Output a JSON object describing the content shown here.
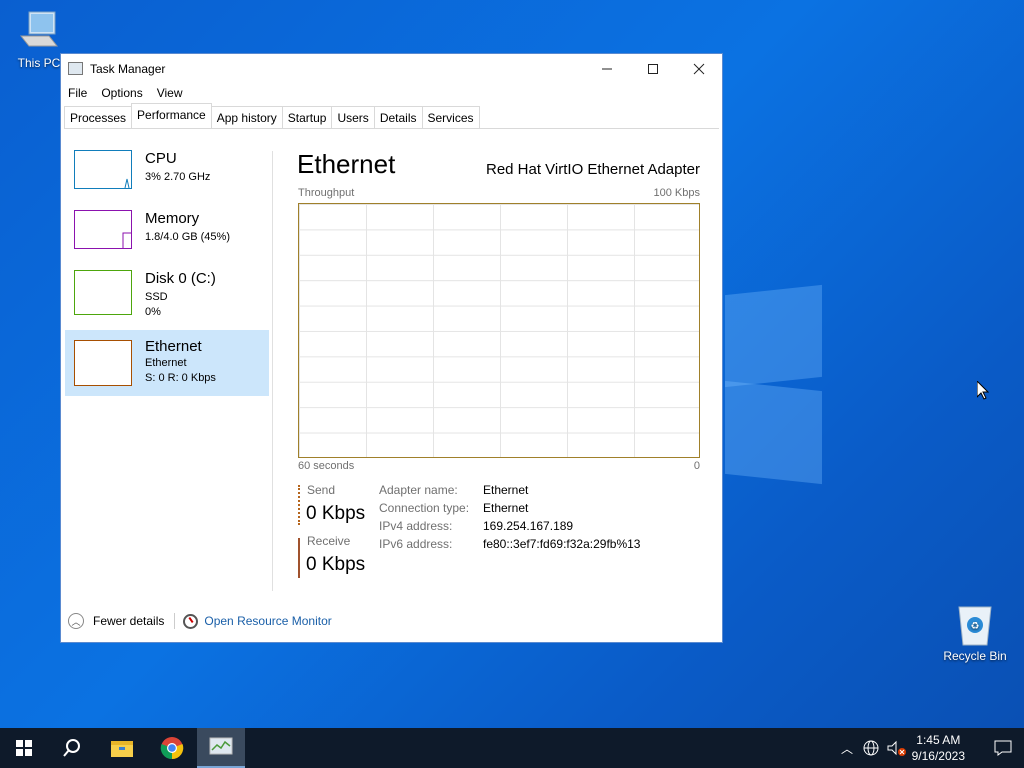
{
  "desktop": {
    "this_pc_label": "This PC",
    "recycle_bin_label": "Recycle Bin"
  },
  "window": {
    "title": "Task Manager",
    "menu": [
      "File",
      "Options",
      "View"
    ],
    "tabs": [
      "Processes",
      "Performance",
      "App history",
      "Startup",
      "Users",
      "Details",
      "Services"
    ],
    "active_tab": "Performance"
  },
  "sidebar": {
    "items": [
      {
        "name": "CPU",
        "line1": "3%  2.70 GHz",
        "line2": "",
        "color": "#117dbb"
      },
      {
        "name": "Memory",
        "line1": "1.8/4.0 GB (45%)",
        "line2": "",
        "color": "#8b12ae"
      },
      {
        "name": "Disk 0 (C:)",
        "line1": "SSD",
        "line2": "0%",
        "color": "#4da60c"
      },
      {
        "name": "Ethernet",
        "line1": "Ethernet",
        "line2": "S: 0  R: 0 Kbps",
        "color": "#a74f01"
      }
    ]
  },
  "main": {
    "title": "Ethernet",
    "adapter": "Red Hat VirtIO Ethernet Adapter",
    "throughput_label": "Throughput",
    "max_label": "100 Kbps",
    "time_label": "60 seconds",
    "min_label": "0",
    "send_label": "Send",
    "send_value": "0 Kbps",
    "receive_label": "Receive",
    "receive_value": "0 Kbps",
    "details": [
      {
        "key": "Adapter name:",
        "value": "Ethernet"
      },
      {
        "key": "Connection type:",
        "value": "Ethernet"
      },
      {
        "key": "IPv4 address:",
        "value": "169.254.167.189"
      },
      {
        "key": "IPv6 address:",
        "value": "fe80::3ef7:fd69:f32a:29fb%13"
      }
    ]
  },
  "footer": {
    "fewer_details": "Fewer details",
    "open_resource_monitor": "Open Resource Monitor"
  },
  "taskbar": {
    "time": "1:45 AM",
    "date": "9/16/2023"
  }
}
